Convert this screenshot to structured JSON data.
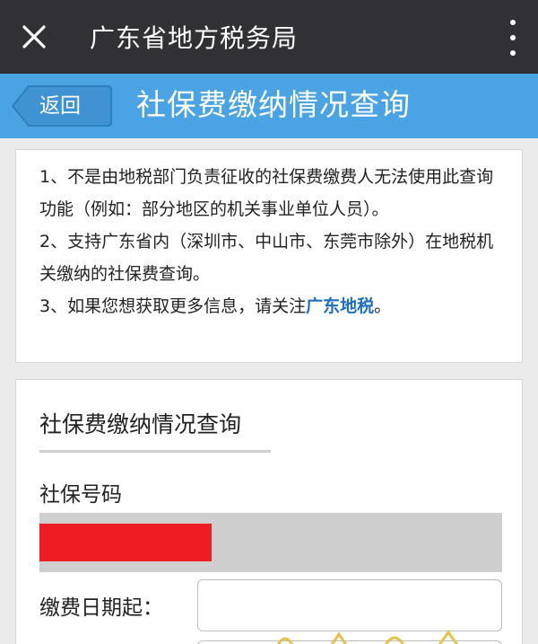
{
  "topbar": {
    "title": "广东省地方税务局"
  },
  "header": {
    "back_label": "返回",
    "title": "社保费缴纳情况查询"
  },
  "notice": {
    "line1": "1、不是由地税部门负责征收的社保费缴费人无法使用此查询功能（例如：部分地区的机关事业单位人员）。",
    "line2": "2、支持广东省内（深圳市、中山市、东莞市除外）在地税机关缴纳的社保费查询。",
    "line3_prefix": "3、如果您想获取更多信息，请关注",
    "line3_link": "广东地税",
    "line3_suffix": "。"
  },
  "form": {
    "title": "社保费缴纳情况查询",
    "sn_label": "社保号码",
    "date_start_label": "缴费日期起："
  },
  "colors": {
    "topbar": "#313135",
    "header": "#4aa3e3",
    "link": "#1e6fbf",
    "redaction": "#ee1c25"
  }
}
